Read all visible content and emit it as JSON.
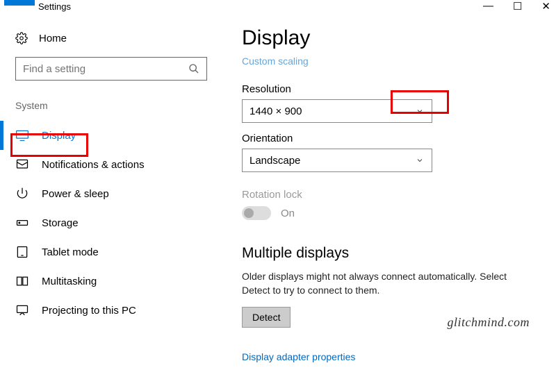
{
  "titlebar": {
    "title": "Settings"
  },
  "sidebar": {
    "home_label": "Home",
    "search_placeholder": "Find a setting",
    "section_label": "System",
    "items": [
      {
        "label": "Display"
      },
      {
        "label": "Notifications & actions"
      },
      {
        "label": "Power & sleep"
      },
      {
        "label": "Storage"
      },
      {
        "label": "Tablet mode"
      },
      {
        "label": "Multitasking"
      },
      {
        "label": "Projecting to this PC"
      }
    ]
  },
  "main": {
    "title": "Display",
    "truncated_link": "Custom scaling",
    "resolution": {
      "label": "Resolution",
      "value": "1440 × 900"
    },
    "orientation": {
      "label": "Orientation",
      "value": "Landscape"
    },
    "rotation": {
      "label": "Rotation lock",
      "state": "On"
    },
    "multi": {
      "heading": "Multiple displays",
      "text": "Older displays might not always connect automatically. Select Detect to try to connect to them.",
      "detect": "Detect"
    },
    "adapter_link": "Display adapter properties"
  },
  "watermark": "glitchmind.com"
}
